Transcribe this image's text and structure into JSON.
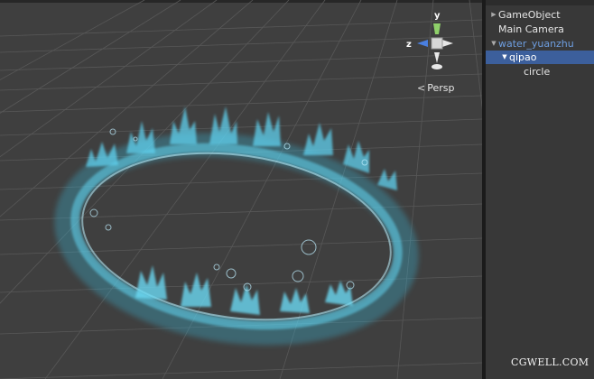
{
  "scene": {
    "view_mode": "Persp",
    "gizmo": {
      "y_label": "y",
      "z_label": "z"
    },
    "colors": {
      "background": "#3f3f3f",
      "grid": "#5a5a5a",
      "splash": "#5fd4f0",
      "y_axis": "#8fd06a",
      "z_axis": "#4a7fe0"
    }
  },
  "hierarchy": {
    "items": [
      {
        "label": "GameObject",
        "expanded": false
      },
      {
        "label": "Main Camera"
      },
      {
        "label": "water_yuanzhu",
        "expanded": true
      },
      {
        "label": "qipao",
        "expanded": true,
        "selected": true
      },
      {
        "label": "circle"
      }
    ]
  },
  "watermark": "CGWELL.COM"
}
